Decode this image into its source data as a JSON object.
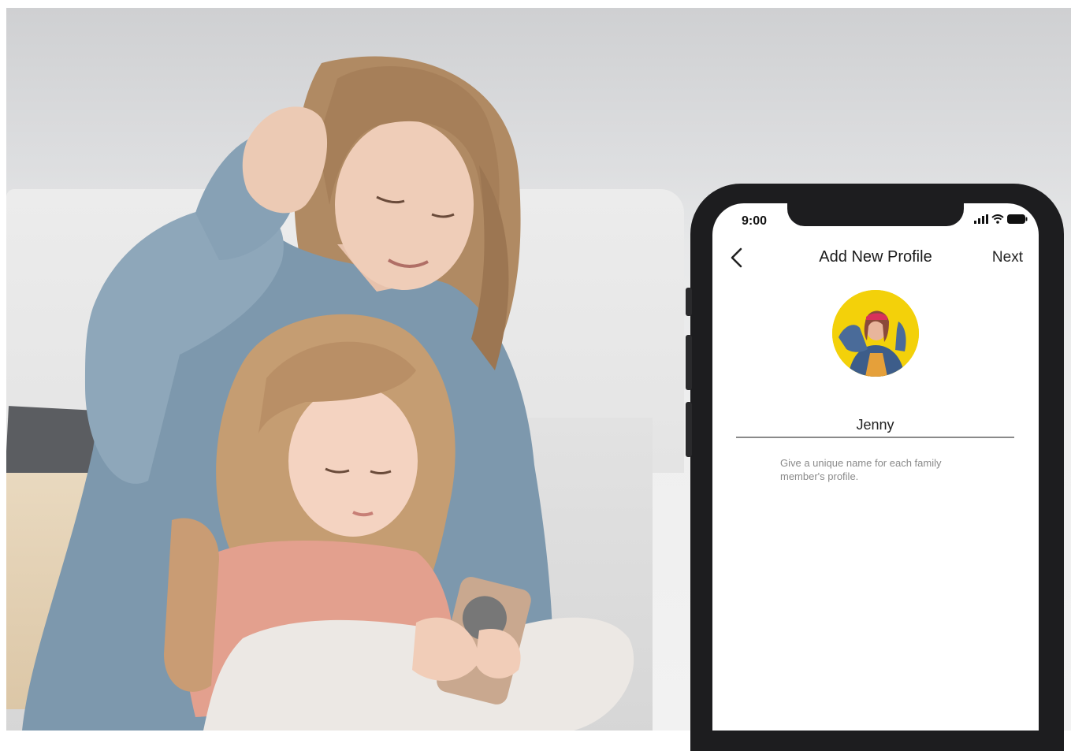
{
  "phone": {
    "status_time": "9:00",
    "nav": {
      "back_label": "",
      "title": "Add New Profile",
      "next_label": "Next"
    },
    "profile": {
      "name_value": "Jenny",
      "hint": "Give a unique name for each family member's profile."
    },
    "icons": [
      "back-chevron-icon",
      "cellular-signal-icon",
      "wifi-icon",
      "battery-icon",
      "profile-avatar"
    ],
    "colors": {
      "avatar_background": "#f3d10a",
      "phone_frame": "#1d1d1f",
      "text_primary": "#1a1a1a",
      "hint_text": "#8a8a8a"
    }
  }
}
